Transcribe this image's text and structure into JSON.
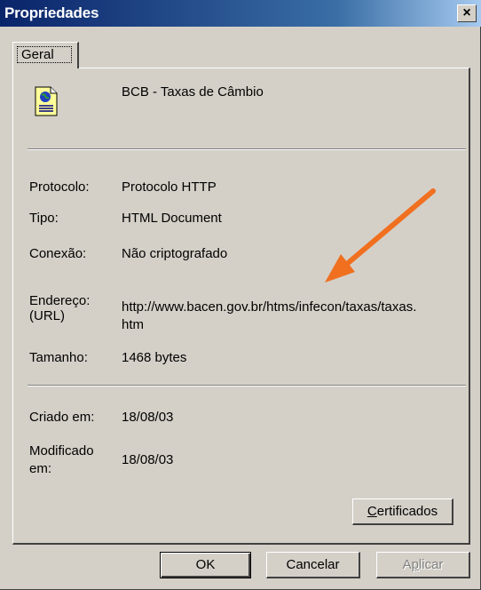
{
  "window": {
    "title": "Propriedades",
    "close_glyph": "×"
  },
  "tabs": [
    {
      "label": "Geral"
    }
  ],
  "file": {
    "icon": "html-document-icon",
    "name": "BCB - Taxas de Câmbio"
  },
  "properties": {
    "protocol_label": "Protocolo:",
    "protocol_value": "Protocolo HTTP",
    "type_label": "Tipo:",
    "type_value": "HTML Document",
    "connection_label": "Conexão:",
    "connection_value": "Não criptografado",
    "address_label_1": "Endereço:",
    "address_label_2": "(URL)",
    "address_value_1": "http://www.bacen.gov.br/htms/infecon/taxas/taxas.",
    "address_value_2": "htm",
    "size_label": "Tamanho:",
    "size_value": "1468 bytes",
    "created_label": "Criado em:",
    "created_value": "18/08/03",
    "modified_label_1": "Modificado",
    "modified_label_2": "em:",
    "modified_value": "18/08/03"
  },
  "buttons": {
    "certificates_first": "C",
    "certificates_rest": "ertificados",
    "ok": "OK",
    "cancel": "Cancelar",
    "apply_first": "A",
    "apply_mid": "p",
    "apply_rest": "licar"
  },
  "annotation": {
    "arrow_color": "#f07020"
  },
  "colors": {
    "titlebar_start": "#0a246a",
    "titlebar_end": "#a6caf0",
    "face": "#d4d0c8"
  }
}
